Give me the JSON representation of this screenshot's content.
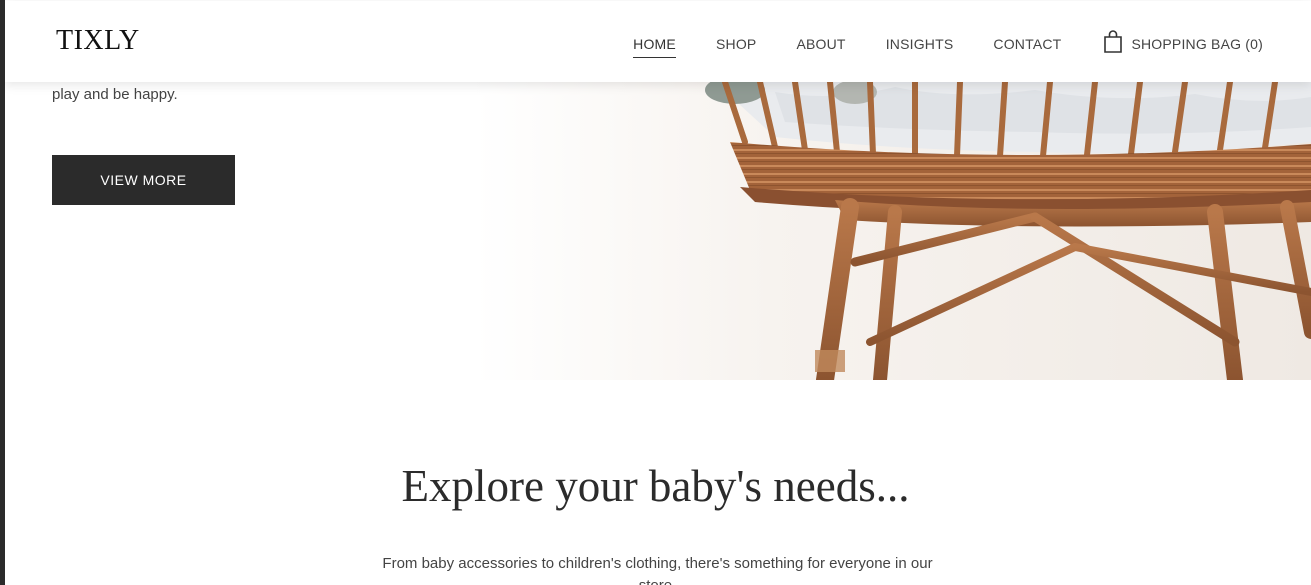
{
  "brand": {
    "logo": "TIXLY"
  },
  "nav": {
    "items": [
      {
        "label": "HOME",
        "active": true
      },
      {
        "label": "SHOP",
        "active": false
      },
      {
        "label": "ABOUT",
        "active": false
      },
      {
        "label": "INSIGHTS",
        "active": false
      },
      {
        "label": "CONTACT",
        "active": false
      }
    ],
    "bag_label": "SHOPPING BAG (0)",
    "bag_icon": "shopping-bag-icon"
  },
  "hero": {
    "text": "play and be happy.",
    "button_label": "VIEW MORE",
    "image": "wicker-bassinet-photo"
  },
  "explore": {
    "title": "Explore your baby's needs...",
    "subtitle": "From baby accessories to children's clothing, there's something for everyone in our store."
  },
  "colors": {
    "button_bg": "#2b2b2b",
    "text": "#444444",
    "wicker": "#a9683a",
    "background": "#ffffff"
  }
}
